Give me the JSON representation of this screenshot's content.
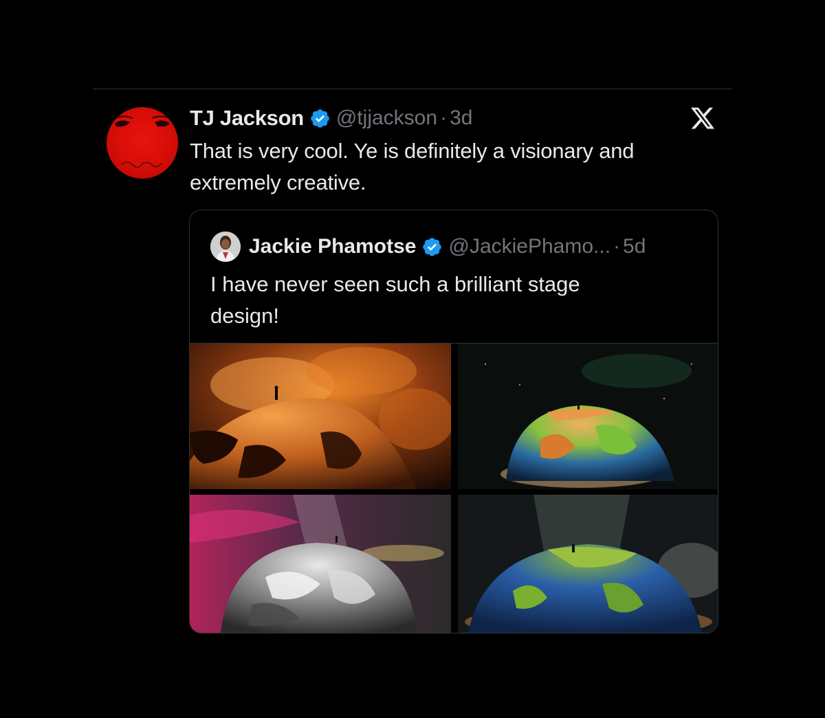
{
  "tweet": {
    "display_name": "TJ Jackson",
    "handle": "@tjjackson",
    "separator": "·",
    "time": "3d",
    "text": "That is very cool. Ye is definitely a visionary and extremely creative."
  },
  "quoted_tweet": {
    "display_name": "Jackie Phamotse",
    "handle": "@JackiePhamo...",
    "separator": "·",
    "time": "5d",
    "text": "I have never seen such a brilliant stage design!"
  },
  "icons": {
    "verified": "verified-badge-icon",
    "brand": "x-logo-icon"
  },
  "colors": {
    "background": "#000000",
    "text_primary": "#e7e9ea",
    "text_secondary": "#71767b",
    "verified_blue": "#1d9bf0",
    "border": "#2f3336"
  }
}
